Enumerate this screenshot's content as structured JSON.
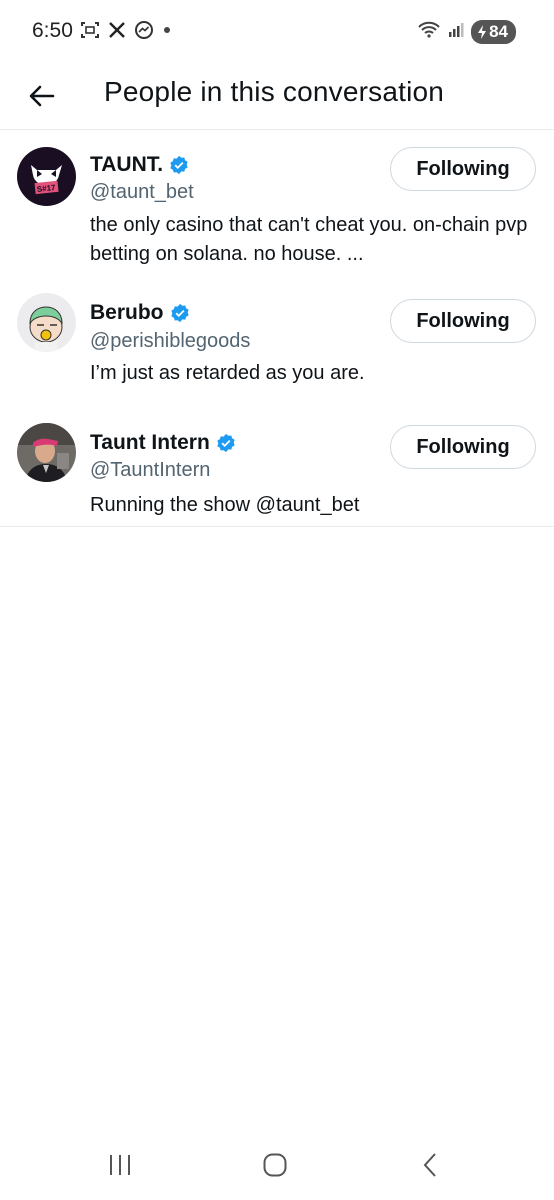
{
  "status_bar": {
    "time": "6:50",
    "battery_level": "84",
    "left_icons": [
      "screenshot-icon",
      "x-app-icon",
      "messenger-icon",
      "dot-icon"
    ],
    "right_icons": [
      "wifi-icon",
      "signal-icon",
      "battery-icon"
    ]
  },
  "header": {
    "back_icon": "arrow-left-icon",
    "title": "People in this conversation"
  },
  "users": [
    {
      "name": "TAUNT.",
      "handle": "@taunt_bet",
      "verified": true,
      "bio": "the only casino that can't cheat you. on-chain pvp betting on solana. no house. ...",
      "follow_label": "Following",
      "avatar_text": "S#17"
    },
    {
      "name": "Berubo",
      "handle": "@perishiblegoods",
      "verified": true,
      "bio": "I’m just as retarded as you are.",
      "follow_label": "Following"
    },
    {
      "name": "Taunt Intern",
      "handle": "@TauntIntern",
      "verified": true,
      "bio": "Running the show @taunt_bet",
      "follow_label": "Following"
    }
  ],
  "nav_bar": {
    "buttons": [
      "recents-icon",
      "home-icon",
      "back-icon"
    ]
  },
  "colors": {
    "verified": "#1d9bf0",
    "divider": "#e6ecf0",
    "handle": "#536471",
    "text": "#0f1419"
  }
}
